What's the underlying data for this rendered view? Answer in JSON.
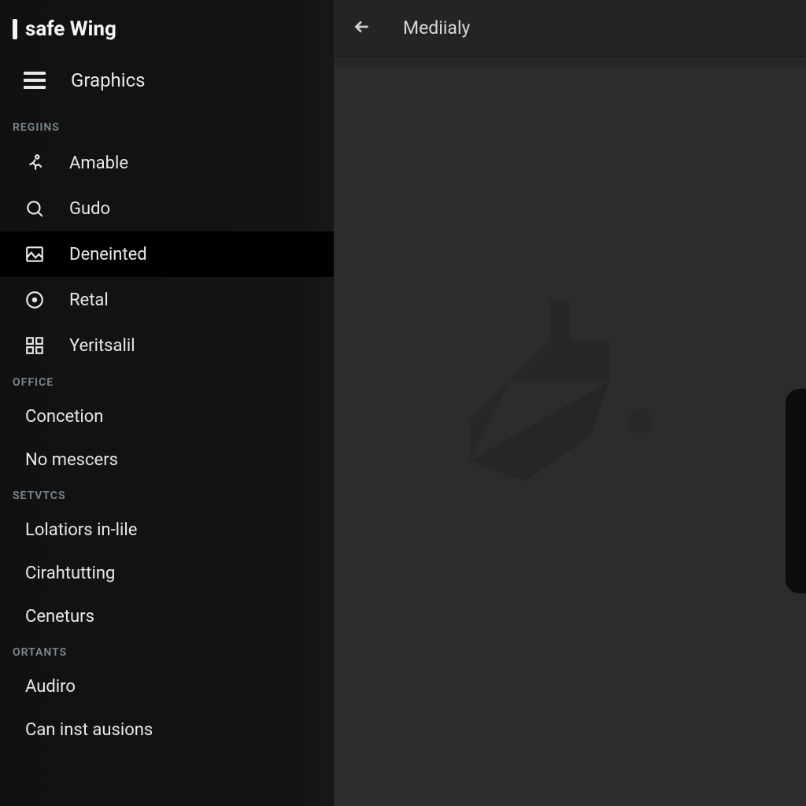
{
  "brand": {
    "title": "safe Wing"
  },
  "sidebar": {
    "graphics_label": "Graphics",
    "sections": [
      {
        "header": "REGIINS",
        "items": [
          {
            "label": "Amable",
            "icon": "running-icon",
            "selected": false
          },
          {
            "label": "Gudo",
            "icon": "search-icon",
            "selected": false
          },
          {
            "label": "Deneinted",
            "icon": "image-icon",
            "selected": true
          },
          {
            "label": "Retal",
            "icon": "record-icon",
            "selected": false
          },
          {
            "label": "Yeritsalil",
            "icon": "grid-icon",
            "selected": false
          }
        ]
      },
      {
        "header": "OFFICE",
        "items": [
          {
            "label": "Concetion",
            "icon": null,
            "selected": false
          },
          {
            "label": "No mescers",
            "icon": null,
            "selected": false
          }
        ]
      },
      {
        "header": "SETVTCS",
        "items": [
          {
            "label": "Lolatiors in-lile",
            "icon": null,
            "selected": false
          },
          {
            "label": "Cirahtutting",
            "icon": null,
            "selected": false
          },
          {
            "label": "Ceneturs",
            "icon": null,
            "selected": false
          }
        ]
      },
      {
        "header": "ORTANTS",
        "items": [
          {
            "label": "Audiro",
            "icon": null,
            "selected": false
          },
          {
            "label": "Can inst ausions",
            "icon": null,
            "selected": false
          }
        ]
      }
    ]
  },
  "main": {
    "title": "Mediialy"
  }
}
